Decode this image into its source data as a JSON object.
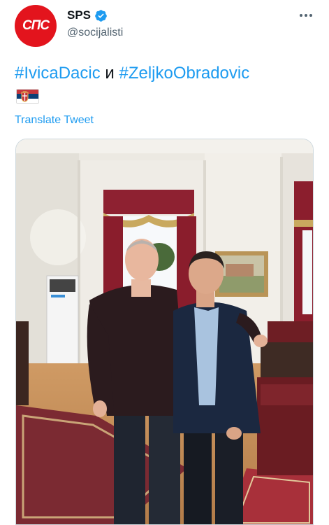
{
  "account": {
    "display_name": "SPS",
    "handle": "@socijalisti",
    "avatar_text": "СПС",
    "avatar_color": "#e3141d",
    "verified": true
  },
  "tweet": {
    "hashtag_1": "#IvicaDacic",
    "conjunction": "и",
    "hashtag_2": "#ZeljkoObradovic",
    "flag": "serbia-flag",
    "translate_label": "Translate Tweet"
  },
  "colors": {
    "link": "#1d9bf0",
    "text": "#0f1419",
    "secondary": "#536471"
  },
  "icons": {
    "verified": "verified-badge-icon",
    "more": "more-options-icon"
  }
}
